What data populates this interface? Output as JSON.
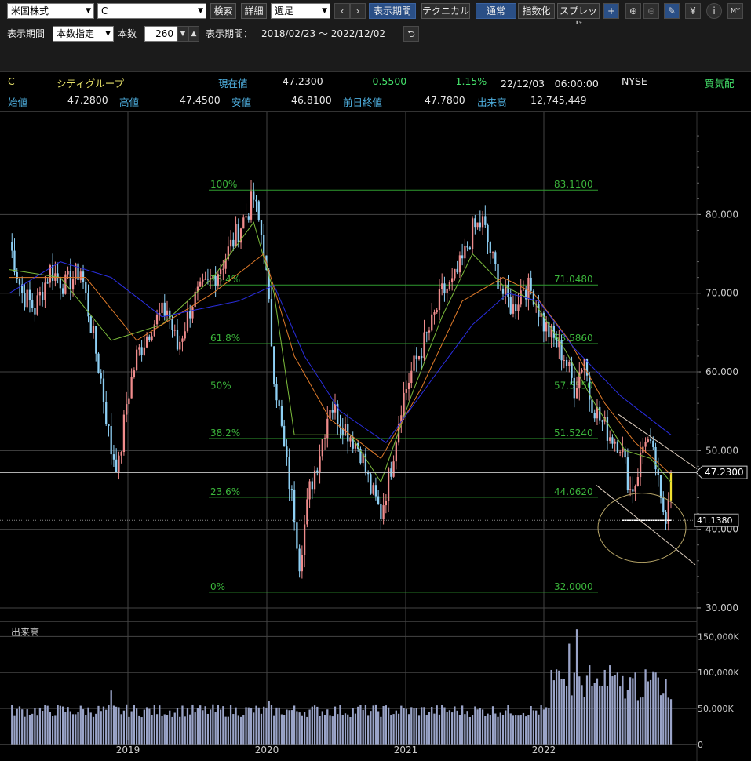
{
  "toolbar": {
    "market": "米国株式",
    "symbol": "C",
    "search_btn": "検索",
    "detail_btn": "詳細",
    "interval": "週足",
    "prev": "‹",
    "next": "›",
    "period_btn": "表示期間",
    "technical_btn": "テクニカル",
    "mode_normal": "通常",
    "mode_index": "指数化",
    "mode_spread": "スプレッド"
  },
  "period_bar": {
    "label": "表示期間",
    "mode": "本数指定",
    "count_label": "本数",
    "count": "260",
    "range_label": "表示期間：",
    "range": "2018/02/23 ～ 2022/12/02"
  },
  "quote": {
    "code": "C",
    "name": "シティグループ",
    "price_label": "現在値",
    "price": "47.2300",
    "change": "-0.5500",
    "change_pct": "-1.15%",
    "datetime": "22/12/03　06:00:00",
    "exchange": "NYSE",
    "board": "買気配",
    "open_label": "始値",
    "open": "47.2800",
    "high_label": "高値",
    "high": "47.4500",
    "low_label": "安値",
    "low": "46.8100",
    "prev_close_label": "前日終値",
    "prev_close": "47.7800",
    "volume_label": "出来高",
    "volume": "12,745,449"
  },
  "chart_data": [
    {
      "type": "candlestick",
      "title": "",
      "y_ticks": [
        "80.000",
        "70.000",
        "60.000",
        "50.000",
        "40.000",
        "30.000"
      ],
      "ylim": [
        28.5,
        92.5
      ],
      "x_ticks": [
        "2019",
        "2020",
        "2021",
        "2022"
      ],
      "current_price_label": "47.2300",
      "support_label": "41.1380",
      "fibonacci": [
        {
          "pct": "100%",
          "price": "83.1100"
        },
        {
          "pct": "76.4%",
          "price": "71.0480"
        },
        {
          "pct": "61.8%",
          "price": "63.5860"
        },
        {
          "pct": "50%",
          "price": "57.5550"
        },
        {
          "pct": "38.2%",
          "price": "51.5240"
        },
        {
          "pct": "23.6%",
          "price": "44.0620"
        },
        {
          "pct": "0%",
          "price": "32.0000"
        }
      ],
      "close_path": [
        [
          0,
          76.5
        ],
        [
          5,
          70
        ],
        [
          10,
          68
        ],
        [
          16,
          73
        ],
        [
          22,
          71
        ],
        [
          28,
          73
        ],
        [
          32,
          66
        ],
        [
          36,
          59
        ],
        [
          40,
          50
        ],
        [
          43,
          48
        ],
        [
          46,
          56
        ],
        [
          50,
          62
        ],
        [
          56,
          66
        ],
        [
          62,
          68
        ],
        [
          66,
          63
        ],
        [
          72,
          69
        ],
        [
          78,
          71
        ],
        [
          84,
          74
        ],
        [
          90,
          78
        ],
        [
          96,
          82
        ],
        [
          100,
          76
        ],
        [
          104,
          60
        ],
        [
          108,
          50
        ],
        [
          112,
          42
        ],
        [
          114,
          36
        ],
        [
          118,
          45
        ],
        [
          122,
          50
        ],
        [
          126,
          56
        ],
        [
          130,
          54
        ],
        [
          134,
          52
        ],
        [
          138,
          50
        ],
        [
          142,
          45
        ],
        [
          146,
          42
        ],
        [
          150,
          48
        ],
        [
          154,
          56
        ],
        [
          158,
          60
        ],
        [
          162,
          63
        ],
        [
          166,
          66
        ],
        [
          170,
          70
        ],
        [
          174,
          71
        ],
        [
          178,
          74
        ],
        [
          182,
          78
        ],
        [
          186,
          79
        ],
        [
          190,
          74
        ],
        [
          194,
          70
        ],
        [
          198,
          68
        ],
        [
          202,
          71
        ],
        [
          206,
          70
        ],
        [
          210,
          66
        ],
        [
          214,
          64
        ],
        [
          218,
          62
        ],
        [
          222,
          58
        ],
        [
          226,
          62
        ],
        [
          228,
          57
        ],
        [
          232,
          54
        ],
        [
          236,
          52
        ],
        [
          240,
          51
        ],
        [
          244,
          45
        ],
        [
          246,
          46
        ],
        [
          250,
          52
        ],
        [
          254,
          48
        ],
        [
          256,
          43
        ],
        [
          258,
          42
        ],
        [
          260,
          47.2
        ]
      ],
      "ma_short": [
        [
          0,
          73
        ],
        [
          20,
          72
        ],
        [
          40,
          64
        ],
        [
          60,
          66
        ],
        [
          80,
          72
        ],
        [
          96,
          79
        ],
        [
          104,
          70
        ],
        [
          112,
          52
        ],
        [
          122,
          52
        ],
        [
          134,
          52
        ],
        [
          146,
          46
        ],
        [
          158,
          57
        ],
        [
          170,
          67
        ],
        [
          182,
          75
        ],
        [
          194,
          71
        ],
        [
          206,
          69
        ],
        [
          218,
          63
        ],
        [
          230,
          56
        ],
        [
          242,
          50
        ],
        [
          252,
          49
        ],
        [
          260,
          46
        ]
      ],
      "ma_mid": [
        [
          0,
          72
        ],
        [
          30,
          72
        ],
        [
          50,
          64
        ],
        [
          80,
          70
        ],
        [
          100,
          75
        ],
        [
          112,
          62
        ],
        [
          126,
          54
        ],
        [
          146,
          49
        ],
        [
          162,
          58
        ],
        [
          178,
          69
        ],
        [
          194,
          72
        ],
        [
          206,
          70
        ],
        [
          220,
          64
        ],
        [
          234,
          56
        ],
        [
          246,
          51
        ],
        [
          260,
          47
        ]
      ],
      "ma_long": [
        [
          0,
          70
        ],
        [
          20,
          74
        ],
        [
          40,
          72
        ],
        [
          60,
          67
        ],
        [
          90,
          69
        ],
        [
          104,
          71
        ],
        [
          116,
          62
        ],
        [
          130,
          55
        ],
        [
          148,
          51
        ],
        [
          166,
          59
        ],
        [
          182,
          66
        ],
        [
          196,
          70
        ],
        [
          208,
          69
        ],
        [
          222,
          63
        ],
        [
          240,
          57
        ],
        [
          260,
          52
        ]
      ],
      "volume": {
        "label": "出来高",
        "y_ticks": [
          "150,000K",
          "100,000K",
          "50,000K",
          "0"
        ],
        "ymax": 170000,
        "spikes": [
          [
            40,
            75000
          ],
          [
            102,
            60000
          ],
          [
            138,
            55000
          ],
          [
            220,
            140000
          ],
          [
            223,
            160000
          ],
          [
            228,
            110000
          ],
          [
            236,
            110000
          ],
          [
            246,
            100000
          ],
          [
            254,
            100000
          ]
        ]
      },
      "series_colors": {
        "up": "#f08c8c",
        "down": "#8ed0f5",
        "ma_short": "#7cbc3c",
        "ma_mid": "#e07b2a",
        "ma_long": "#2a2ee0"
      }
    }
  ]
}
